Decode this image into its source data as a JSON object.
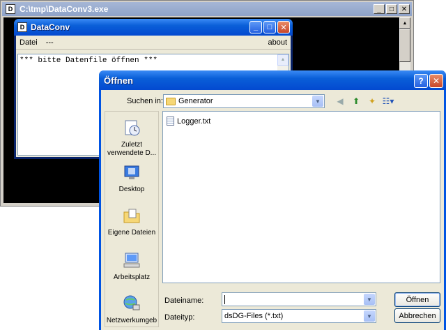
{
  "console": {
    "title": "C:\\tmp\\DataConv3.exe"
  },
  "dataconv": {
    "title": "DataConv",
    "menu": {
      "datei": "Datei",
      "dash": "---",
      "about": "about"
    },
    "text": "*** bitte Datenfile öffnen ***"
  },
  "open_dialog": {
    "title": "Öffnen",
    "help_btn": "?",
    "close_btn": "✕",
    "lookin_label": "Suchen in:",
    "lookin_value": "Generator",
    "places": [
      {
        "label": "Zuletzt verwendete D...",
        "icon": "recent-documents-icon"
      },
      {
        "label": "Desktop",
        "icon": "desktop-icon"
      },
      {
        "label": "Eigene Dateien",
        "icon": "my-documents-icon"
      },
      {
        "label": "Arbeitsplatz",
        "icon": "my-computer-icon"
      },
      {
        "label": "Netzwerkumgeb",
        "icon": "network-places-icon"
      }
    ],
    "files": [
      {
        "name": "Logger.txt",
        "icon": "text-file-icon"
      }
    ],
    "filename_label": "Dateiname:",
    "filename_value": "",
    "filetype_label": "Dateityp:",
    "filetype_value": "dsDG-Files (*.txt)",
    "open_button": "Öffnen",
    "cancel_button": "Abbrechen"
  }
}
